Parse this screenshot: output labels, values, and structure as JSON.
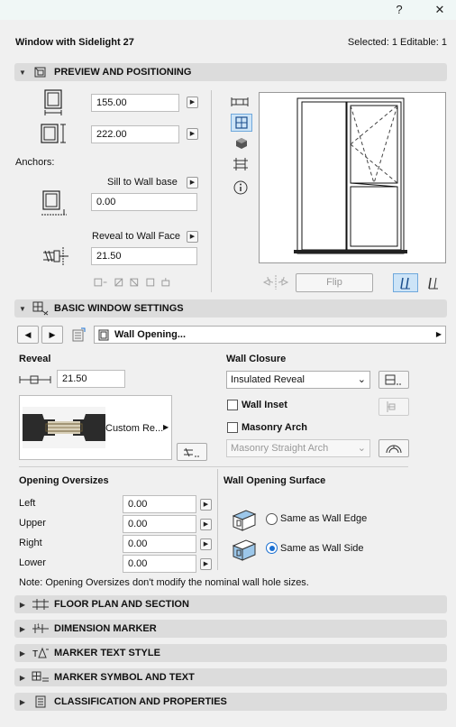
{
  "titlebar": {
    "help": "?",
    "close": "✕"
  },
  "header": {
    "title": "Window with Sidelight 27",
    "selection": "Selected: 1 Editable: 1"
  },
  "sections": {
    "preview": "PREVIEW AND POSITIONING",
    "basic": "BASIC WINDOW SETTINGS",
    "floor_plan": "FLOOR PLAN AND SECTION",
    "dimension": "DIMENSION MARKER",
    "marker_text": "MARKER TEXT STYLE",
    "marker_symbol": "MARKER SYMBOL AND TEXT",
    "classification": "CLASSIFICATION AND PROPERTIES"
  },
  "preview": {
    "width_value": "155.00",
    "height_value": "222.00",
    "anchors_label": "Anchors:",
    "sill_label": "Sill to Wall base",
    "sill_value": "0.00",
    "reveal_label": "Reveal to Wall Face",
    "reveal_value": "21.50",
    "flip_label": "Flip"
  },
  "basic": {
    "panel_name": "Wall Opening...",
    "reveal_title": "Reveal",
    "reveal_value": "21.50",
    "custom_reveal": "Custom Re...",
    "wall_closure_title": "Wall Closure",
    "wall_closure_value": "Insulated Reveal",
    "wall_inset_label": "Wall Inset",
    "masonry_arch_label": "Masonry Arch",
    "masonry_arch_value": "Masonry Straight Arch",
    "oversizes_title": "Opening Oversizes",
    "oversizes": [
      {
        "label": "Left",
        "value": "0.00"
      },
      {
        "label": "Upper",
        "value": "0.00"
      },
      {
        "label": "Right",
        "value": "0.00"
      },
      {
        "label": "Lower",
        "value": "0.00"
      }
    ],
    "surface_title": "Wall Opening Surface",
    "surface_edge": "Same as Wall Edge",
    "surface_side": "Same as Wall Side",
    "note": "Note: Opening Oversizes don't modify the nominal wall hole sizes."
  },
  "colors": {
    "accent": "#1a6fd1",
    "section_bg": "#dcdcdc"
  }
}
